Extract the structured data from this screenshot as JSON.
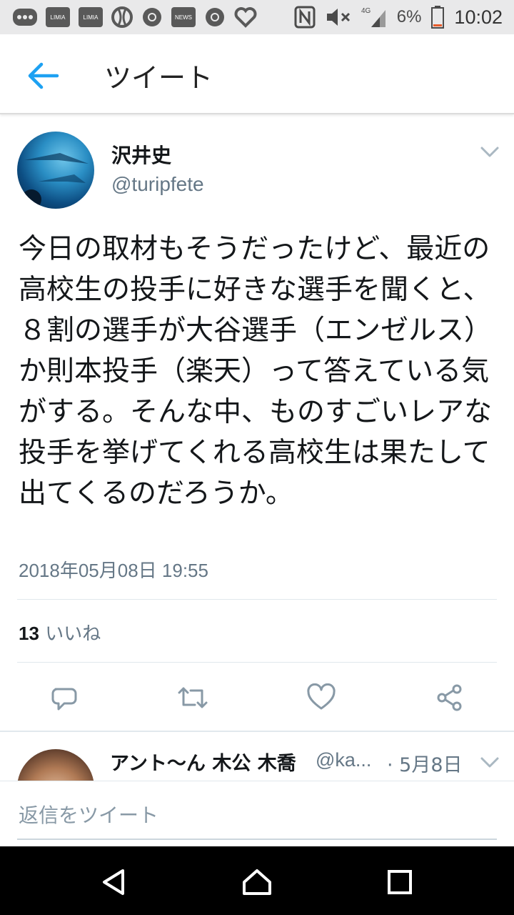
{
  "status_bar": {
    "left_icons": [
      "menu-dots-icon",
      "limia-app-icon",
      "limia-app-icon",
      "ball-icon",
      "chrome-icon",
      "news-icon",
      "chrome-icon",
      "heart-icon"
    ],
    "limia_label": "LIMIA",
    "news_label": "NEWS",
    "network": "4G",
    "battery": "6%",
    "time": "10:02"
  },
  "app_bar": {
    "title": "ツイート"
  },
  "tweet": {
    "display_name": "沢井史",
    "handle": "@turipfete",
    "text": "今日の取材もそうだったけど、最近の高校生の投手に好きな選手を聞くと、８割の選手が大谷選手（エンゼルス）か則本投手（楽天）って答えている気がする。そんな中、ものすごいレアな投手を挙げてくれる高校生は果たして出てくるのだろうか。",
    "timestamp": "2018年05月08日 19:55",
    "likes_count": "13",
    "likes_label": "いいね",
    "actions": [
      "reply-icon",
      "retweet-icon",
      "like-icon",
      "share-icon"
    ]
  },
  "reply_preview": {
    "display_name": "アント〜ん 木公 木喬",
    "handle": "@ka...",
    "date": "· 5月8日"
  },
  "compose": {
    "placeholder": "返信をツイート"
  },
  "colors": {
    "accent": "#1da1f2",
    "secondary_text": "#657786",
    "action_icon": "#8899a6"
  }
}
